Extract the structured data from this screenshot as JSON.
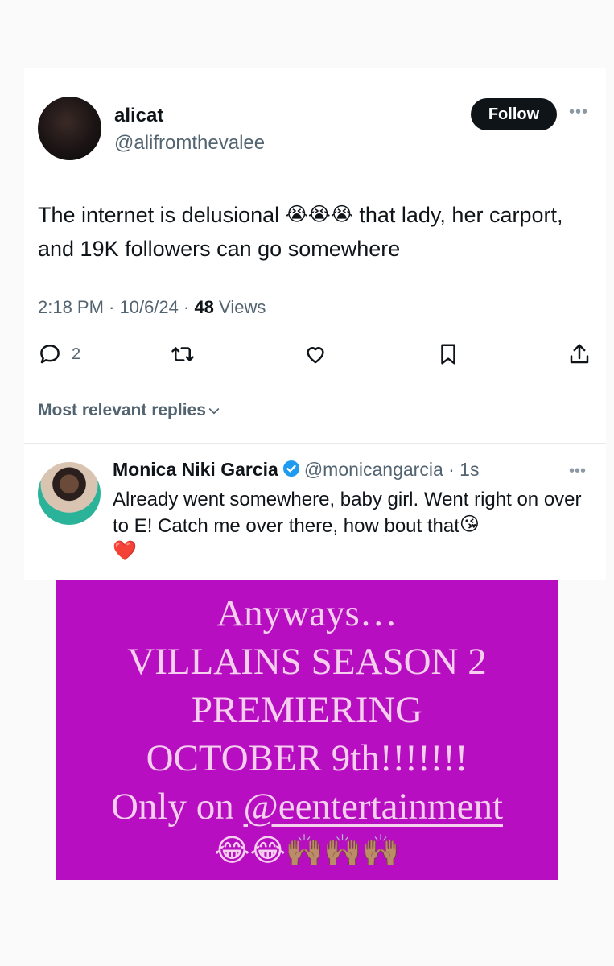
{
  "tweet": {
    "display_name": "alicat",
    "handle": "@alifromthevalee",
    "follow_label": "Follow",
    "more_icon": "more-icon",
    "text_part1": "The internet is delusional",
    "text_emoji": "😭😭😭",
    "text_part2": "that lady, her carport, and 19K followers can go somewhere",
    "time": "2:18 PM · 10/6/24 · ",
    "views_count": "48",
    "views_label": "Views",
    "reply_count": "2",
    "replies_sort_label": "Most relevant replies"
  },
  "reply": {
    "name": "Monica Niki Garcia",
    "handle_time": "@monicangarcia · 1s",
    "text": "Already went somewhere, baby girl. Went right on over to E! Catch me over there, how bout that",
    "text_emoji": "😘",
    "heart_emoji": "❤️"
  },
  "promo": {
    "line1": "Anyways…",
    "line2": "VILLAINS SEASON 2",
    "line3": "PREMIERING",
    "line4": "OCTOBER 9th!!!!!!!",
    "line5_prefix": "Only on ",
    "line5_link": "@eentertainment",
    "emoji": "😂😂🙌🏽🙌🏽🙌🏽"
  },
  "colors": {
    "promo_bg": "#b60ec0",
    "promo_text": "#f6cfef",
    "follow_bg": "#0f1419",
    "verified": "#1d9bf0",
    "secondary_text": "#536471"
  }
}
